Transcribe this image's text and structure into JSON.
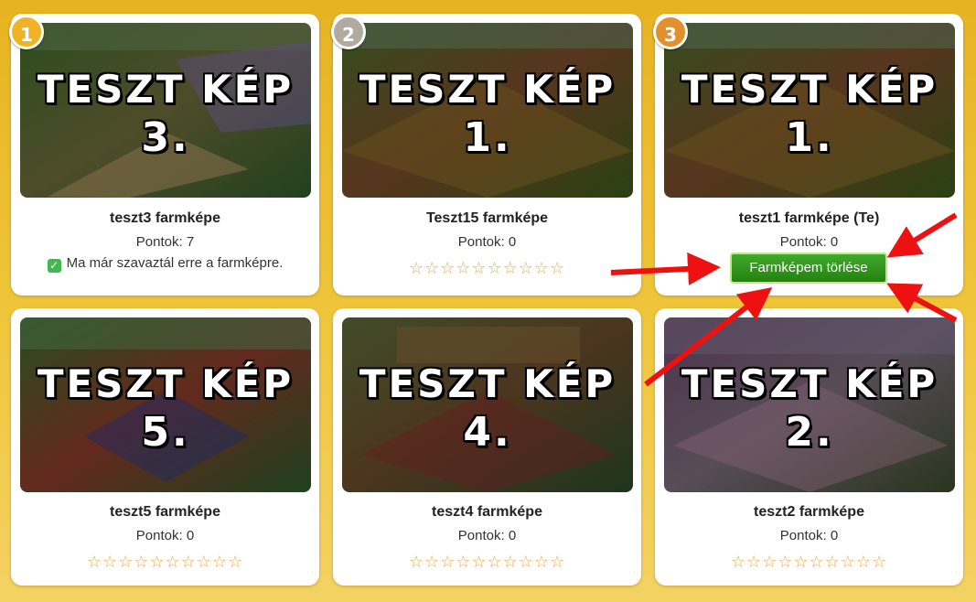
{
  "cards": [
    {
      "rank": "1",
      "rank_color": "#f0b323",
      "img_title": "TESZT KÉP",
      "img_num": "3.",
      "name": "teszt3 farmképe",
      "points": "Pontok: 7",
      "voted": "Ma már szavaztál erre a farmképre."
    },
    {
      "rank": "2",
      "rank_color": "#b0aaa0",
      "img_title": "TESZT KÉP",
      "img_num": "1.",
      "name": "Teszt15 farmképe",
      "points": "Pontok: 0",
      "stars": "☆☆☆☆☆☆☆☆☆☆"
    },
    {
      "rank": "3",
      "rank_color": "#e0902c",
      "img_title": "TESZT KÉP",
      "img_num": "1.",
      "name": "teszt1 farmképe (Te)",
      "points": "Pontok: 0",
      "delete_label": "Farmképem törlése"
    },
    {
      "img_title": "TESZT KÉP",
      "img_num": "5.",
      "name": "teszt5 farmképe",
      "points": "Pontok: 0",
      "stars": "☆☆☆☆☆☆☆☆☆☆"
    },
    {
      "img_title": "TESZT KÉP",
      "img_num": "4.",
      "name": "teszt4 farmképe",
      "points": "Pontok: 0",
      "stars": "☆☆☆☆☆☆☆☆☆☆"
    },
    {
      "img_title": "TESZT KÉP",
      "img_num": "2.",
      "name": "teszt2 farmképe",
      "points": "Pontok: 0",
      "stars": "☆☆☆☆☆☆☆☆☆☆"
    }
  ],
  "colors": {
    "accent_green": "#2e9419",
    "arrow_red": "#ee1111",
    "background": "#eebf33"
  }
}
